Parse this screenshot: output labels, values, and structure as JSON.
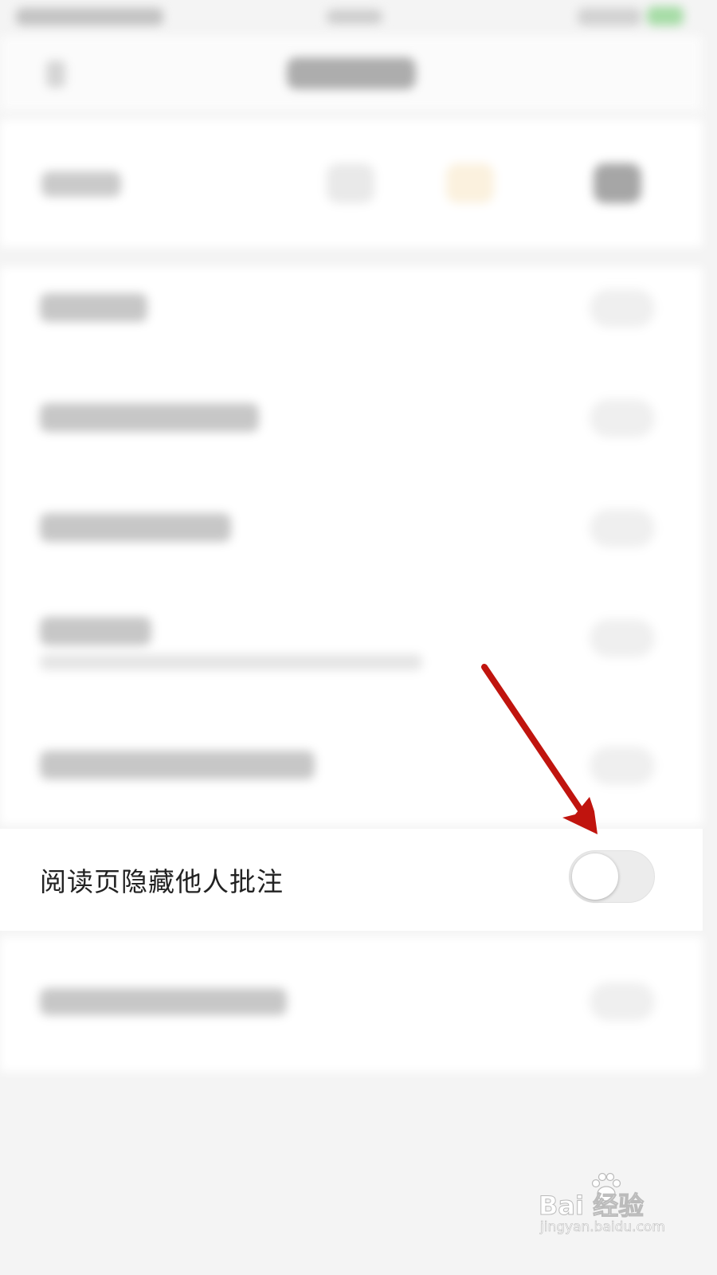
{
  "setting": {
    "label": "阅读页隐藏他人批注",
    "toggle_state": "off"
  },
  "watermark": {
    "brand": "Bai  经验",
    "url": "jingyan.baidu.com"
  },
  "colors": {
    "annotation_arrow": "#c0140e",
    "toggle_track_off": "#ececec",
    "background": "#f4f4f4"
  }
}
